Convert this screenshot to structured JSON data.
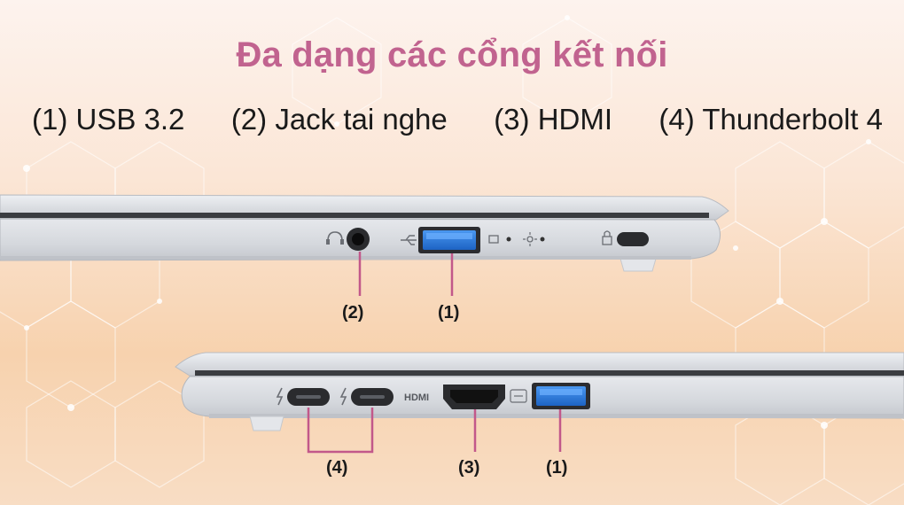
{
  "title": "Đa dạng các cổng kết nối",
  "ports": [
    {
      "label": "(1) USB 3.2"
    },
    {
      "label": "(2) Jack tai nghe"
    },
    {
      "label": "(3) HDMI"
    },
    {
      "label": "(4) Thunderbolt 4"
    }
  ],
  "top_view": {
    "callouts": [
      "(2)",
      "(1)"
    ]
  },
  "bottom_view": {
    "hdmi_logo": "HDMI",
    "callouts": [
      "(4)",
      "(3)",
      "(1)"
    ]
  },
  "colors": {
    "title": "#c1638f",
    "usb_blue": "#2f7fe0",
    "chassis": "#d9dce1"
  }
}
